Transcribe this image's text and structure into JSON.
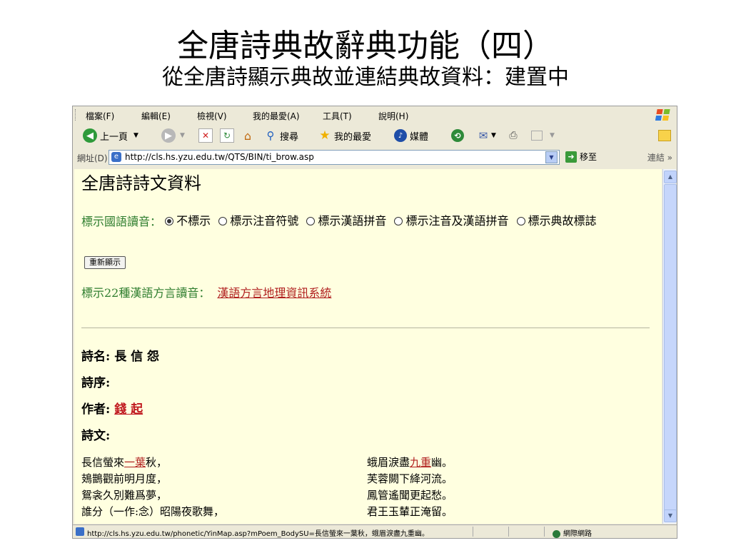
{
  "slide": {
    "title": "全唐詩典故辭典功能（四）",
    "subtitle": "從全唐詩顯示典故並連結典故資料：建置中"
  },
  "menu": [
    "檔案(F)",
    "編輯(E)",
    "檢視(V)",
    "我的最愛(A)",
    "工具(T)",
    "說明(H)"
  ],
  "toolbar": {
    "back": "上一頁",
    "search": "搜尋",
    "favorites": "我的最愛",
    "media": "媒體"
  },
  "address": {
    "label": "網址(D)",
    "url": "http://cls.hs.yzu.edu.tw/QTS/BIN/ti_brow.asp",
    "go": "移至",
    "links": "連結"
  },
  "page": {
    "heading": "全唐詩詩文資料",
    "phonetic_label": "標示國語讀音：",
    "options": [
      "不標示",
      "標示注音符號",
      "標示漢語拼音",
      "標示注音及漢語拼音",
      "標示典故標誌"
    ],
    "selected_option": "不標示",
    "refresh_button": "重新顯示",
    "dialect_label": "標示22種漢語方言讀音：",
    "dialect_link": "漢語方言地理資訊系統",
    "poem_name_label": "詩名:",
    "poem_name": "長 信 怨",
    "preface_label": "詩序:",
    "author_label": "作者:",
    "author": "錢 起",
    "text_label": "詩文:",
    "lines_left": [
      {
        "pre": "長信螢來",
        "link": "一葉",
        "post": "秋，"
      },
      {
        "pre": "鳷鵲觀前明月度，",
        "link": "",
        "post": ""
      },
      {
        "pre": "鴛衾久別難爲夢，",
        "link": "",
        "post": ""
      },
      {
        "pre": "誰分（一作:念）昭陽夜歌舞，",
        "link": "",
        "post": ""
      }
    ],
    "lines_right": [
      {
        "pre": "蛾眉淚盡",
        "link": "九重",
        "post": "幽。"
      },
      {
        "pre": "芙蓉闕下絳河流。",
        "link": "",
        "post": ""
      },
      {
        "pre": "鳳管遙聞更起愁。",
        "link": "",
        "post": ""
      },
      {
        "pre": "君王玉輦正淹留。",
        "link": "",
        "post": ""
      }
    ]
  },
  "status": {
    "text": "http://cls.hs.yzu.edu.tw/phonetic/YinMap.asp?mPoem_BodySU=長信螢來一葉秋，蛾眉淚盡九重幽。",
    "zone": "網際網路"
  }
}
